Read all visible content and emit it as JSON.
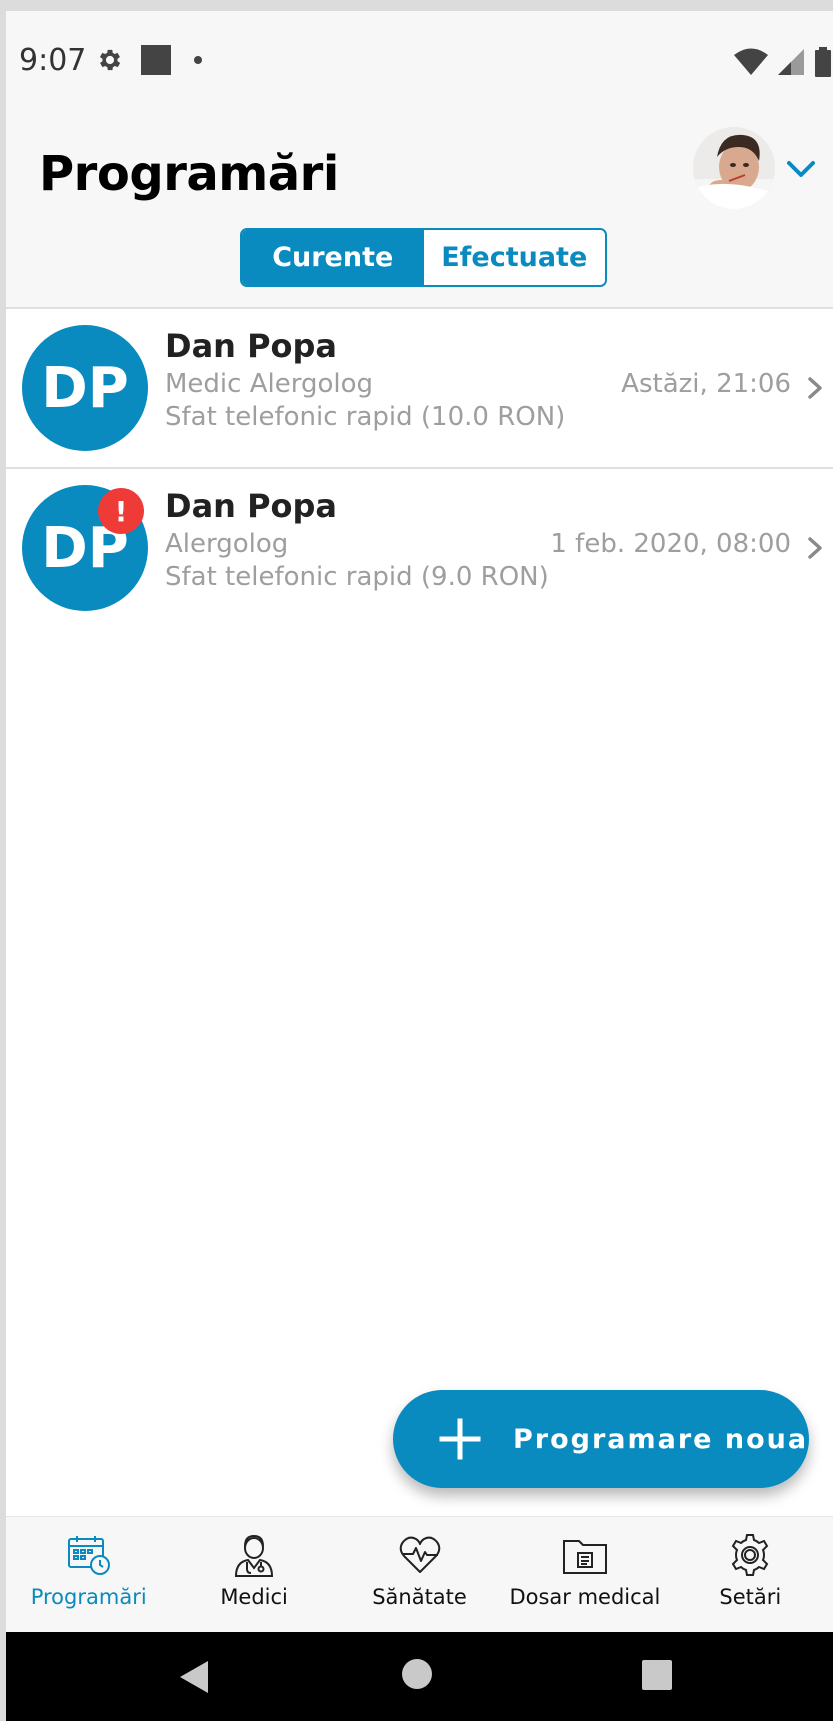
{
  "status_bar": {
    "time": "9:07",
    "icons": [
      "settings-icon",
      "square-notification-icon",
      "dot-icon",
      "wifi-icon",
      "signal-icon",
      "battery-icon"
    ]
  },
  "header": {
    "title": "Programări",
    "profile_icon": "user-avatar-photo",
    "dropdown_icon": "chevron-down-icon"
  },
  "tabs": {
    "items": [
      {
        "label": "Curente",
        "active": true
      },
      {
        "label": "Efectuate",
        "active": false
      }
    ]
  },
  "appointments": [
    {
      "initials": "DP",
      "name": "Dan Popa",
      "specialty": "Medic Alergolog",
      "service": "Sfat telefonic rapid (10.0 RON)",
      "datetime": "Astăzi, 21:06",
      "alert": false
    },
    {
      "initials": "DP",
      "name": "Dan Popa",
      "specialty": "Alergolog",
      "service": "Sfat telefonic rapid (9.0 RON)",
      "datetime": "1 feb. 2020, 08:00",
      "alert": true,
      "alert_text": "!"
    }
  ],
  "fab": {
    "label": "Programare noua",
    "icon": "plus-icon"
  },
  "bottom_nav": {
    "items": [
      {
        "label": "Programări",
        "icon": "calendar-clock-icon",
        "active": true
      },
      {
        "label": "Medici",
        "icon": "doctor-icon",
        "active": false
      },
      {
        "label": "Sănătate",
        "icon": "heart-pulse-icon",
        "active": false
      },
      {
        "label": "Dosar medical",
        "icon": "folder-document-icon",
        "active": false
      },
      {
        "label": "Setări",
        "icon": "gear-icon",
        "active": false
      }
    ]
  },
  "system_nav": {
    "icons": [
      "back-icon",
      "home-icon",
      "recents-icon"
    ]
  },
  "colors": {
    "accent": "#0a8bbf",
    "alert": "#ef3b37",
    "secondary_text": "#9e9e9e"
  }
}
